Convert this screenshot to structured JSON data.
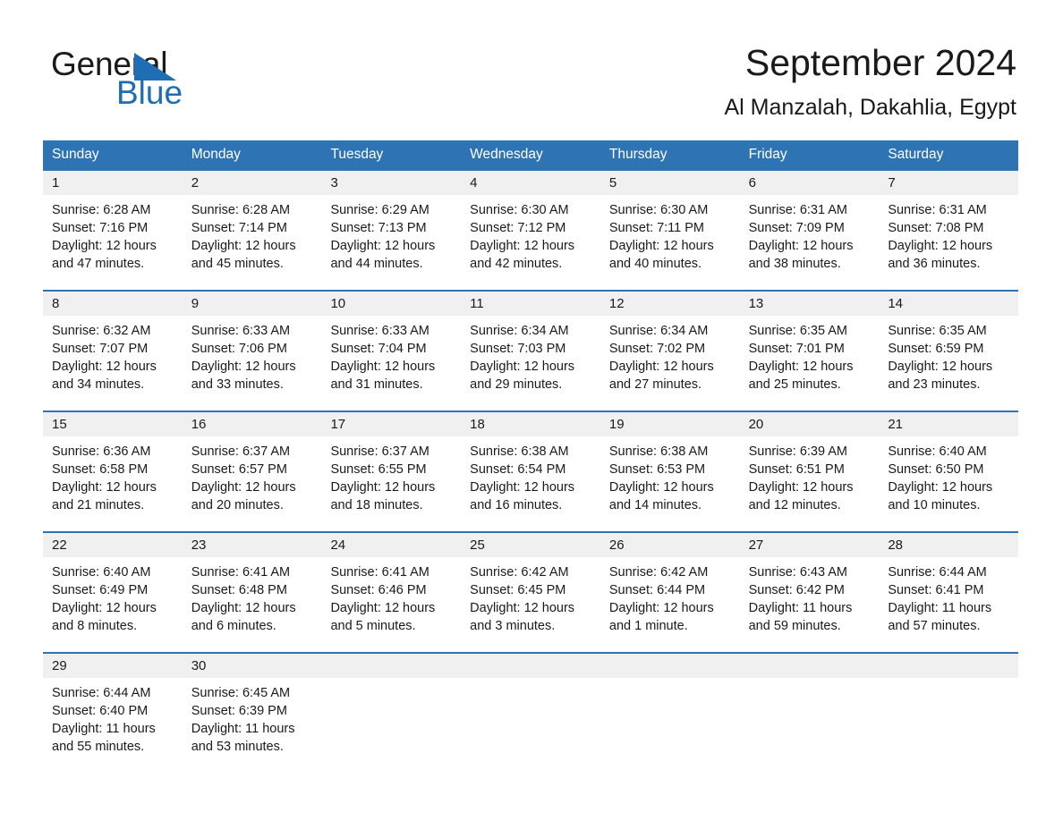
{
  "brand": {
    "name_part1": "General",
    "name_part2": "Blue",
    "logo_icon": "triangle-logo-icon",
    "accent_color": "#1f6db4"
  },
  "header": {
    "title": "September 2024",
    "location": "Al Manzalah, Dakahlia, Egypt"
  },
  "theme": {
    "header_blue": "#2e74b5",
    "daynum_band": "#f0f0f0",
    "page_background": "#ffffff",
    "text_color": "#1a1a1a"
  },
  "calendar": {
    "weekdays": [
      "Sunday",
      "Monday",
      "Tuesday",
      "Wednesday",
      "Thursday",
      "Friday",
      "Saturday"
    ],
    "weeks": [
      {
        "days": [
          {
            "date": "1",
            "sunrise": "Sunrise: 6:28 AM",
            "sunset": "Sunset: 7:16 PM",
            "daylight_line1": "Daylight: 12 hours",
            "daylight_line2": "and 47 minutes."
          },
          {
            "date": "2",
            "sunrise": "Sunrise: 6:28 AM",
            "sunset": "Sunset: 7:14 PM",
            "daylight_line1": "Daylight: 12 hours",
            "daylight_line2": "and 45 minutes."
          },
          {
            "date": "3",
            "sunrise": "Sunrise: 6:29 AM",
            "sunset": "Sunset: 7:13 PM",
            "daylight_line1": "Daylight: 12 hours",
            "daylight_line2": "and 44 minutes."
          },
          {
            "date": "4",
            "sunrise": "Sunrise: 6:30 AM",
            "sunset": "Sunset: 7:12 PM",
            "daylight_line1": "Daylight: 12 hours",
            "daylight_line2": "and 42 minutes."
          },
          {
            "date": "5",
            "sunrise": "Sunrise: 6:30 AM",
            "sunset": "Sunset: 7:11 PM",
            "daylight_line1": "Daylight: 12 hours",
            "daylight_line2": "and 40 minutes."
          },
          {
            "date": "6",
            "sunrise": "Sunrise: 6:31 AM",
            "sunset": "Sunset: 7:09 PM",
            "daylight_line1": "Daylight: 12 hours",
            "daylight_line2": "and 38 minutes."
          },
          {
            "date": "7",
            "sunrise": "Sunrise: 6:31 AM",
            "sunset": "Sunset: 7:08 PM",
            "daylight_line1": "Daylight: 12 hours",
            "daylight_line2": "and 36 minutes."
          }
        ]
      },
      {
        "days": [
          {
            "date": "8",
            "sunrise": "Sunrise: 6:32 AM",
            "sunset": "Sunset: 7:07 PM",
            "daylight_line1": "Daylight: 12 hours",
            "daylight_line2": "and 34 minutes."
          },
          {
            "date": "9",
            "sunrise": "Sunrise: 6:33 AM",
            "sunset": "Sunset: 7:06 PM",
            "daylight_line1": "Daylight: 12 hours",
            "daylight_line2": "and 33 minutes."
          },
          {
            "date": "10",
            "sunrise": "Sunrise: 6:33 AM",
            "sunset": "Sunset: 7:04 PM",
            "daylight_line1": "Daylight: 12 hours",
            "daylight_line2": "and 31 minutes."
          },
          {
            "date": "11",
            "sunrise": "Sunrise: 6:34 AM",
            "sunset": "Sunset: 7:03 PM",
            "daylight_line1": "Daylight: 12 hours",
            "daylight_line2": "and 29 minutes."
          },
          {
            "date": "12",
            "sunrise": "Sunrise: 6:34 AM",
            "sunset": "Sunset: 7:02 PM",
            "daylight_line1": "Daylight: 12 hours",
            "daylight_line2": "and 27 minutes."
          },
          {
            "date": "13",
            "sunrise": "Sunrise: 6:35 AM",
            "sunset": "Sunset: 7:01 PM",
            "daylight_line1": "Daylight: 12 hours",
            "daylight_line2": "and 25 minutes."
          },
          {
            "date": "14",
            "sunrise": "Sunrise: 6:35 AM",
            "sunset": "Sunset: 6:59 PM",
            "daylight_line1": "Daylight: 12 hours",
            "daylight_line2": "and 23 minutes."
          }
        ]
      },
      {
        "days": [
          {
            "date": "15",
            "sunrise": "Sunrise: 6:36 AM",
            "sunset": "Sunset: 6:58 PM",
            "daylight_line1": "Daylight: 12 hours",
            "daylight_line2": "and 21 minutes."
          },
          {
            "date": "16",
            "sunrise": "Sunrise: 6:37 AM",
            "sunset": "Sunset: 6:57 PM",
            "daylight_line1": "Daylight: 12 hours",
            "daylight_line2": "and 20 minutes."
          },
          {
            "date": "17",
            "sunrise": "Sunrise: 6:37 AM",
            "sunset": "Sunset: 6:55 PM",
            "daylight_line1": "Daylight: 12 hours",
            "daylight_line2": "and 18 minutes."
          },
          {
            "date": "18",
            "sunrise": "Sunrise: 6:38 AM",
            "sunset": "Sunset: 6:54 PM",
            "daylight_line1": "Daylight: 12 hours",
            "daylight_line2": "and 16 minutes."
          },
          {
            "date": "19",
            "sunrise": "Sunrise: 6:38 AM",
            "sunset": "Sunset: 6:53 PM",
            "daylight_line1": "Daylight: 12 hours",
            "daylight_line2": "and 14 minutes."
          },
          {
            "date": "20",
            "sunrise": "Sunrise: 6:39 AM",
            "sunset": "Sunset: 6:51 PM",
            "daylight_line1": "Daylight: 12 hours",
            "daylight_line2": "and 12 minutes."
          },
          {
            "date": "21",
            "sunrise": "Sunrise: 6:40 AM",
            "sunset": "Sunset: 6:50 PM",
            "daylight_line1": "Daylight: 12 hours",
            "daylight_line2": "and 10 minutes."
          }
        ]
      },
      {
        "days": [
          {
            "date": "22",
            "sunrise": "Sunrise: 6:40 AM",
            "sunset": "Sunset: 6:49 PM",
            "daylight_line1": "Daylight: 12 hours",
            "daylight_line2": "and 8 minutes."
          },
          {
            "date": "23",
            "sunrise": "Sunrise: 6:41 AM",
            "sunset": "Sunset: 6:48 PM",
            "daylight_line1": "Daylight: 12 hours",
            "daylight_line2": "and 6 minutes."
          },
          {
            "date": "24",
            "sunrise": "Sunrise: 6:41 AM",
            "sunset": "Sunset: 6:46 PM",
            "daylight_line1": "Daylight: 12 hours",
            "daylight_line2": "and 5 minutes."
          },
          {
            "date": "25",
            "sunrise": "Sunrise: 6:42 AM",
            "sunset": "Sunset: 6:45 PM",
            "daylight_line1": "Daylight: 12 hours",
            "daylight_line2": "and 3 minutes."
          },
          {
            "date": "26",
            "sunrise": "Sunrise: 6:42 AM",
            "sunset": "Sunset: 6:44 PM",
            "daylight_line1": "Daylight: 12 hours",
            "daylight_line2": "and 1 minute."
          },
          {
            "date": "27",
            "sunrise": "Sunrise: 6:43 AM",
            "sunset": "Sunset: 6:42 PM",
            "daylight_line1": "Daylight: 11 hours",
            "daylight_line2": "and 59 minutes."
          },
          {
            "date": "28",
            "sunrise": "Sunrise: 6:44 AM",
            "sunset": "Sunset: 6:41 PM",
            "daylight_line1": "Daylight: 11 hours",
            "daylight_line2": "and 57 minutes."
          }
        ]
      },
      {
        "days": [
          {
            "date": "29",
            "sunrise": "Sunrise: 6:44 AM",
            "sunset": "Sunset: 6:40 PM",
            "daylight_line1": "Daylight: 11 hours",
            "daylight_line2": "and 55 minutes."
          },
          {
            "date": "30",
            "sunrise": "Sunrise: 6:45 AM",
            "sunset": "Sunset: 6:39 PM",
            "daylight_line1": "Daylight: 11 hours",
            "daylight_line2": "and 53 minutes."
          },
          {
            "date": "",
            "sunrise": "",
            "sunset": "",
            "daylight_line1": "",
            "daylight_line2": ""
          },
          {
            "date": "",
            "sunrise": "",
            "sunset": "",
            "daylight_line1": "",
            "daylight_line2": ""
          },
          {
            "date": "",
            "sunrise": "",
            "sunset": "",
            "daylight_line1": "",
            "daylight_line2": ""
          },
          {
            "date": "",
            "sunrise": "",
            "sunset": "",
            "daylight_line1": "",
            "daylight_line2": ""
          },
          {
            "date": "",
            "sunrise": "",
            "sunset": "",
            "daylight_line1": "",
            "daylight_line2": ""
          }
        ]
      }
    ]
  }
}
